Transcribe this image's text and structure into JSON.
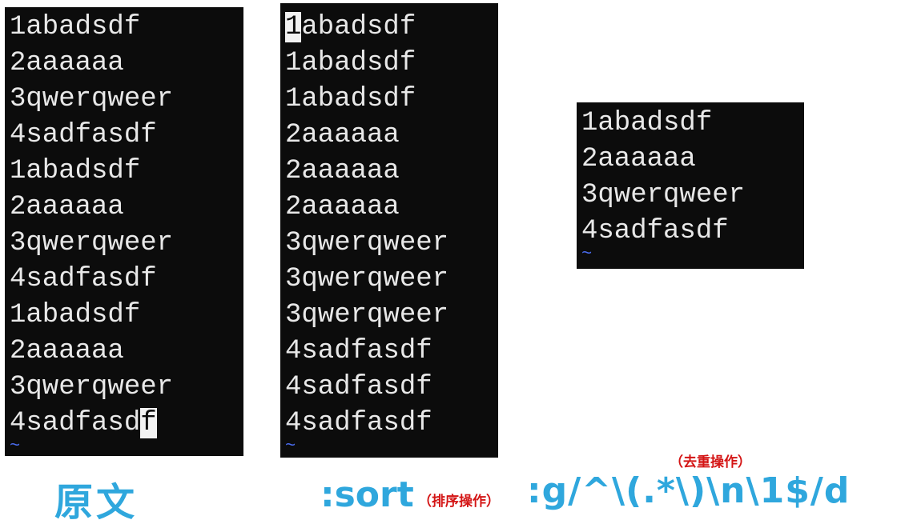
{
  "terminals": {
    "original": {
      "lines": [
        "1abadsdf",
        "2aaaaaa",
        "3qwerqweer",
        "4sadfasdf",
        "1abadsdf",
        "2aaaaaa",
        "3qwerqweer",
        "4sadfasdf",
        "1abadsdf",
        "2aaaaaa",
        "3qwerqweer",
        "4sadfasd"
      ],
      "cursor_char": "f",
      "tilde": "~"
    },
    "sorted": {
      "cursor_char": "1",
      "lines": [
        "abadsdf",
        "1abadsdf",
        "1abadsdf",
        "2aaaaaa",
        "2aaaaaa",
        "2aaaaaa",
        "3qwerqweer",
        "3qwerqweer",
        "3qwerqweer",
        "4sadfasdf",
        "4sadfasdf",
        "4sadfasdf"
      ],
      "tilde": "~"
    },
    "dedup": {
      "lines": [
        "1abadsdf",
        "2aaaaaa",
        "3qwerqweer",
        "4sadfasdf"
      ],
      "tilde": "~"
    }
  },
  "captions": {
    "original": "原文",
    "sort_command": ":sort",
    "sort_note": "（排序操作）",
    "dedup_command": ":g/^\\(.*\\)\\n\\1$/d",
    "dedup_note": "（去重操作）"
  },
  "colors": {
    "terminal_bg": "#0c0c0c",
    "terminal_fg": "#e8e8e8",
    "tilde": "#4a6cf0",
    "caption_blue": "#2fa7dd",
    "note_red": "#d41515"
  }
}
